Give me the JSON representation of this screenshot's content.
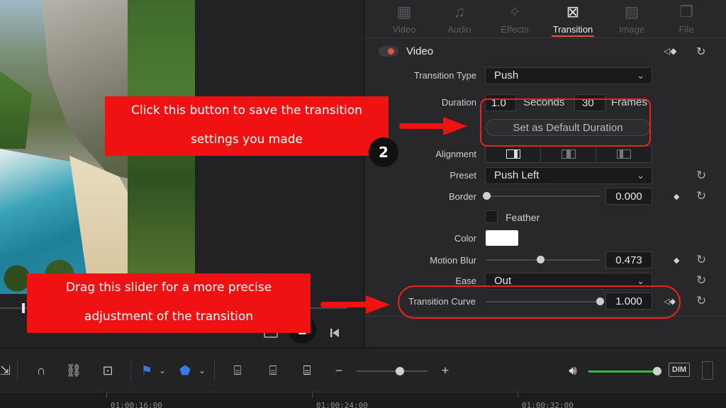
{
  "tabs": [
    {
      "label": "Video",
      "icon": "film-strip-icon",
      "active": false
    },
    {
      "label": "Audio",
      "icon": "music-note-icon",
      "active": false
    },
    {
      "label": "Effects",
      "icon": "magic-wand-icon",
      "active": false
    },
    {
      "label": "Transition",
      "icon": "transition-icon",
      "active": true
    },
    {
      "label": "Image",
      "icon": "image-icon",
      "active": false
    },
    {
      "label": "File",
      "icon": "file-icon",
      "active": false
    }
  ],
  "section": {
    "title": "Video",
    "kf_nav": "◁◆"
  },
  "properties": {
    "transition_type": {
      "label": "Transition Type",
      "value": "Push"
    },
    "duration": {
      "label": "Duration",
      "seconds": "1.0",
      "seconds_unit": "Seconds",
      "frames": "30",
      "frames_unit": "Frames"
    },
    "set_default_label": "Set as Default Duration",
    "alignment": {
      "label": "Alignment"
    },
    "preset": {
      "label": "Preset",
      "value": "Push Left"
    },
    "border": {
      "label": "Border",
      "value": "0.000",
      "level": 0.0
    },
    "feather": {
      "label": "Feather"
    },
    "color": {
      "label": "Color",
      "value": "#ffffff"
    },
    "motion_blur": {
      "label": "Motion Blur",
      "value": "0.473",
      "level": 0.473
    },
    "ease": {
      "label": "Ease",
      "value": "Out"
    },
    "transition_curve": {
      "label": "Transition Curve",
      "value": "1.000",
      "level": 1.0
    }
  },
  "annotations": {
    "save_line1": "Click this button to save the transition",
    "save_line2": "settings you made",
    "drag_line1": "Drag this slider for a more precise",
    "drag_line2": "adjustment of the transition",
    "badge1": "1",
    "badge2": "2",
    "color": "#f01212"
  },
  "toolbar": {
    "dim_label": "DIM",
    "volume_level": 0.95,
    "zoom_level": 0.6,
    "accent_green": "#3fb34a"
  },
  "ruler": {
    "timecodes": [
      "01:00:16:00",
      "01:00:24:00",
      "01:00:32:00"
    ]
  },
  "viewer": {
    "playhead_fraction": 0.065
  }
}
